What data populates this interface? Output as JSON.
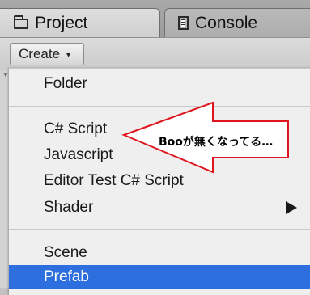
{
  "tabs": [
    {
      "label": "Project",
      "icon": "folder-icon",
      "active": true
    },
    {
      "label": "Console",
      "icon": "console-icon",
      "active": false
    }
  ],
  "toolbar": {
    "create_label": "Create",
    "create_chevron": "▾"
  },
  "menu": {
    "items": [
      {
        "label": "Folder"
      },
      {
        "label": "C# Script"
      },
      {
        "label": "Javascript"
      },
      {
        "label": "Editor Test C# Script"
      },
      {
        "label": "Shader",
        "has_submenu": true
      },
      {
        "label": "Scene"
      },
      {
        "label": "Prefab",
        "selected": true
      }
    ],
    "selected_color": "#2e6fe0"
  },
  "annotation": {
    "text": "Booが無くなってる…",
    "color": "#e0141e"
  }
}
